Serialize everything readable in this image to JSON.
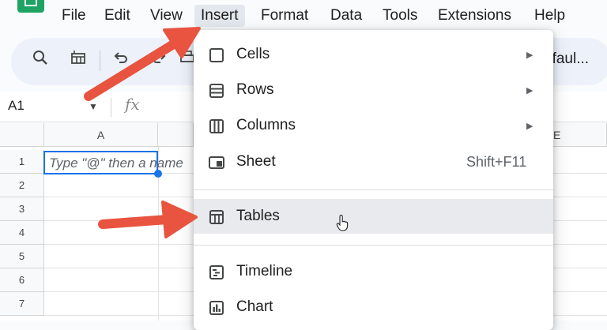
{
  "menubar": {
    "items": [
      {
        "label": "File"
      },
      {
        "label": "Edit"
      },
      {
        "label": "View"
      },
      {
        "label": "Insert",
        "active": true
      },
      {
        "label": "Format"
      },
      {
        "label": "Data"
      },
      {
        "label": "Tools"
      },
      {
        "label": "Extensions"
      },
      {
        "label": "Help"
      }
    ]
  },
  "toolbar": {
    "icons": [
      "search-icon",
      "table-icon",
      "undo-icon",
      "redo-icon",
      "print-icon"
    ],
    "font_name": "efaul..."
  },
  "formula_bar": {
    "name_box": "A1",
    "fx_label": "fx"
  },
  "grid": {
    "columns": [
      "A",
      "E"
    ],
    "rows": [
      "1",
      "2",
      "3",
      "4",
      "5",
      "6",
      "7"
    ],
    "active_cell_text": "Type \"@\" then a name"
  },
  "insert_menu": {
    "items": [
      {
        "label": "Cells",
        "icon": "checkbox-square-icon",
        "submenu": true
      },
      {
        "label": "Rows",
        "icon": "rows-icon",
        "submenu": true
      },
      {
        "label": "Columns",
        "icon": "columns-icon",
        "submenu": true
      },
      {
        "label": "Sheet",
        "icon": "sheet-icon",
        "shortcut": "Shift+F11"
      },
      {
        "label": "Tables",
        "icon": "table-grid-icon",
        "highlighted": true
      },
      {
        "label": "Timeline",
        "icon": "timeline-icon"
      },
      {
        "label": "Chart",
        "icon": "chart-icon"
      }
    ]
  },
  "colors": {
    "accent": "#1a73e8",
    "annotation_arrow": "#e8543f",
    "sheets_green": "#1ea362"
  }
}
